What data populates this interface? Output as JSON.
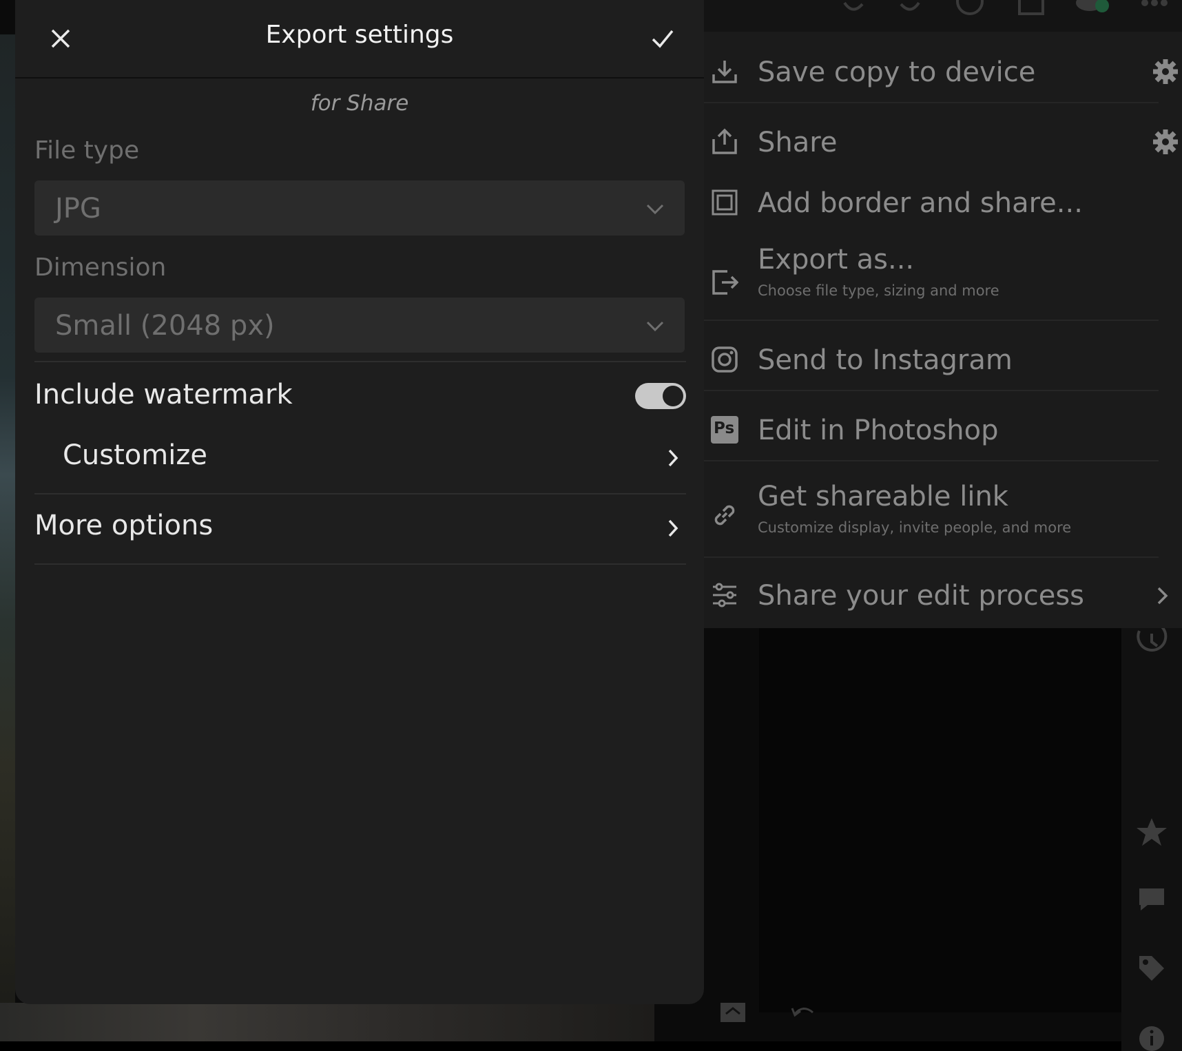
{
  "panel": {
    "title": "Export settings",
    "subtitle": "for Share",
    "file_type_label": "File type",
    "file_type_value": "JPG",
    "dimension_label": "Dimension",
    "dimension_value": "Small (2048 px)",
    "watermark_label": "Include watermark",
    "watermark_on": true,
    "customize_label": "Customize",
    "more_options_label": "More options"
  },
  "menu": {
    "items": [
      {
        "label": "Save copy to device",
        "icon": "download-icon",
        "has_settings": true
      },
      {
        "label": "Share",
        "icon": "share-icon",
        "has_settings": true
      },
      {
        "label": "Add border and share...",
        "icon": "border-icon"
      },
      {
        "label": "Export as...",
        "sub": "Choose file type, sizing and more",
        "icon": "export-icon"
      },
      {
        "label": "Send to Instagram",
        "icon": "instagram-icon"
      },
      {
        "label": "Edit in Photoshop",
        "icon": "photoshop-icon",
        "badge": "Ps"
      },
      {
        "label": "Get shareable link",
        "sub": "Customize display, invite people, and more",
        "icon": "link-icon"
      },
      {
        "label": "Share your edit process",
        "icon": "sliders-icon",
        "has_chevron": true
      }
    ]
  },
  "colors": {
    "panel_bg": "#1e1e1e",
    "menu_bg": "#1b1b1b",
    "text_primary": "#e8e8e8",
    "text_muted": "#6f6f6f"
  }
}
